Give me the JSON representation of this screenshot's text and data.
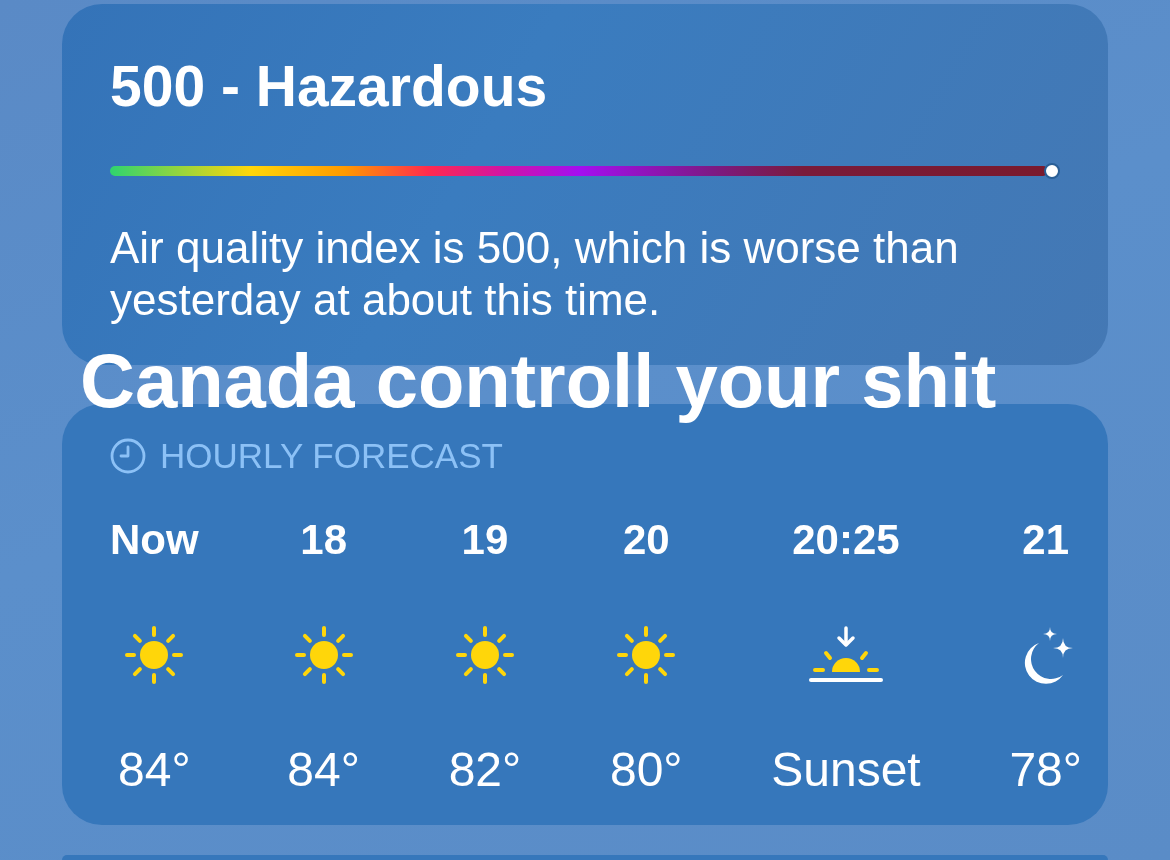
{
  "air_quality": {
    "title": "500 - Hazardous",
    "level": 1.0,
    "description": "Air quality index is 500, which is worse than yesterday at about this time."
  },
  "caption": "Canada controll your shit",
  "hourly_forecast": {
    "heading": "HOURLY FORECAST",
    "hours": [
      {
        "time": "Now",
        "kind": "sun",
        "temp": "84°"
      },
      {
        "time": "18",
        "kind": "sun",
        "temp": "84°"
      },
      {
        "time": "19",
        "kind": "sun",
        "temp": "82°"
      },
      {
        "time": "20",
        "kind": "sun",
        "temp": "80°"
      },
      {
        "time": "20:25",
        "kind": "sunset",
        "temp": "Sunset"
      },
      {
        "time": "21",
        "kind": "moon",
        "temp": "78°"
      }
    ]
  }
}
